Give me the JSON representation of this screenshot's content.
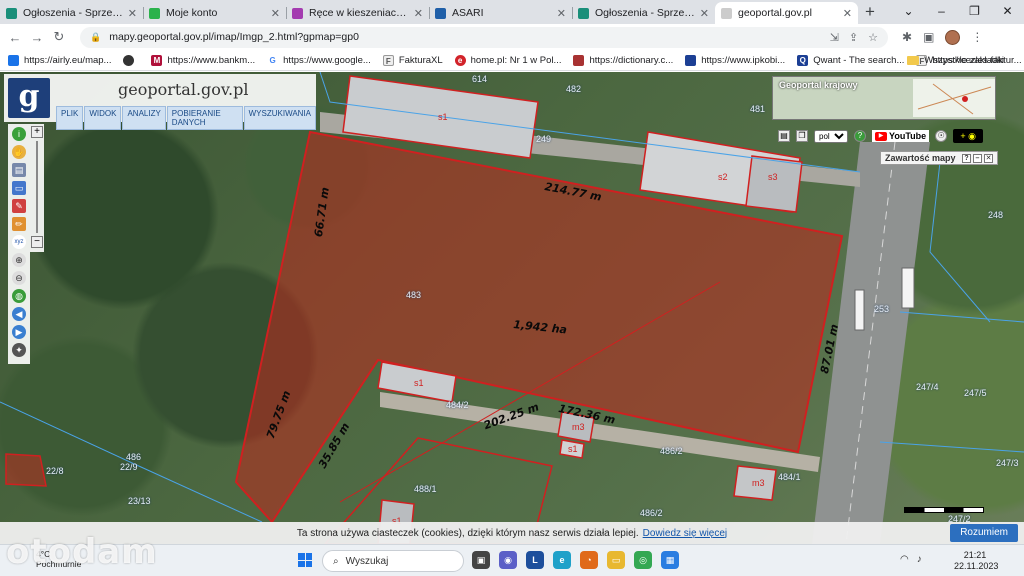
{
  "tabs": [
    {
      "title": "Ogłoszenia - Sprzedam, ku",
      "color": "#1a8f7a"
    },
    {
      "title": "Moje konto",
      "color": "#2bb24c"
    },
    {
      "title": "Ręce w kieszeniach u Klecz",
      "color": "#a43bb0"
    },
    {
      "title": "ASARI",
      "color": "#1f5fa8"
    },
    {
      "title": "Ogłoszenia - Sprzedam, ku",
      "color": "#1a8f7a"
    },
    {
      "title": "geoportal.gov.pl",
      "color": "#cccccc",
      "active": true
    }
  ],
  "url": "mapy.geoportal.gov.pl/imap/Imgp_2.html?gpmap=gp0",
  "bookmarks": [
    {
      "label": "https://airly.eu/map...",
      "color": "#1a73e8",
      "glyph": ""
    },
    {
      "label": "",
      "color": "#333333",
      "glyph": ""
    },
    {
      "label": "https://www.bankm...",
      "color": "#b0103a",
      "glyph": "M"
    },
    {
      "label": "https://www.google...",
      "color": "#ffffff",
      "glyph": "G"
    },
    {
      "label": "FakturaXL",
      "color": "#555555",
      "glyph": "F"
    },
    {
      "label": "home.pl: Nr 1 w Pol...",
      "color": "#d2232a",
      "glyph": "e"
    },
    {
      "label": "https://dictionary.c...",
      "color": "#a83232",
      "glyph": ""
    },
    {
      "label": "https://www.ipkobi...",
      "color": "#1c3f94",
      "glyph": ""
    },
    {
      "label": "Qwant - The search...",
      "color": "#1c3f94",
      "glyph": "Q"
    },
    {
      "label": "https://cezles.faktur...",
      "color": "#555555",
      "glyph": "F"
    }
  ],
  "bookmarks_other": "Wszystkie zakładki",
  "geoportal": {
    "logo_letter": "g",
    "title": "geoportal.gov.pl",
    "menu": [
      "PLIK",
      "WIDOK",
      "ANALIZY",
      "POBIERANIE DANYCH",
      "WYSZUKIWANIA"
    ],
    "overview_title": "Geoportal krajowy",
    "language": "pol",
    "youtube": "YouTube",
    "legend_title": "Zawartość mapy"
  },
  "parcels": {
    "main_area": "1,942 ha",
    "main_number": "483"
  },
  "parcel_labels": [
    {
      "text": "614"
    },
    {
      "text": "482"
    },
    {
      "text": "481"
    },
    {
      "text": "249"
    },
    {
      "text": "248"
    },
    {
      "text": "253"
    },
    {
      "text": "247/4"
    },
    {
      "text": "247/5"
    },
    {
      "text": "247/3"
    },
    {
      "text": "484/2"
    },
    {
      "text": "484/1"
    },
    {
      "text": "486/2"
    },
    {
      "text": "486"
    },
    {
      "text": "22/9"
    },
    {
      "text": "23/13"
    },
    {
      "text": "22/8"
    },
    {
      "text": "486/2"
    },
    {
      "text": "247/2"
    }
  ],
  "dimensions": [
    {
      "text": "214.77 m"
    },
    {
      "text": "66.71 m"
    },
    {
      "text": "87.01 m"
    },
    {
      "text": "79.75 m"
    },
    {
      "text": "35.85 m"
    },
    {
      "text": "202.25 m"
    },
    {
      "text": "172.36 m"
    }
  ],
  "buildings": [
    "s1",
    "s2",
    "s3",
    "s1",
    "m3",
    "s1",
    "m3",
    "s1"
  ],
  "cookie": {
    "text": "Ta strona używa ciasteczek (cookies), dzięki którym nasz serwis działa lepiej.",
    "link": "Dowiedz się więcej",
    "accept": "Rozumiem"
  },
  "taskbar": {
    "weather_temp": "4°C",
    "weather_desc": "Pochmurnie",
    "search": "Wyszukaj",
    "time": "21:21",
    "date": "22.11.2023"
  },
  "watermark": "otodam"
}
